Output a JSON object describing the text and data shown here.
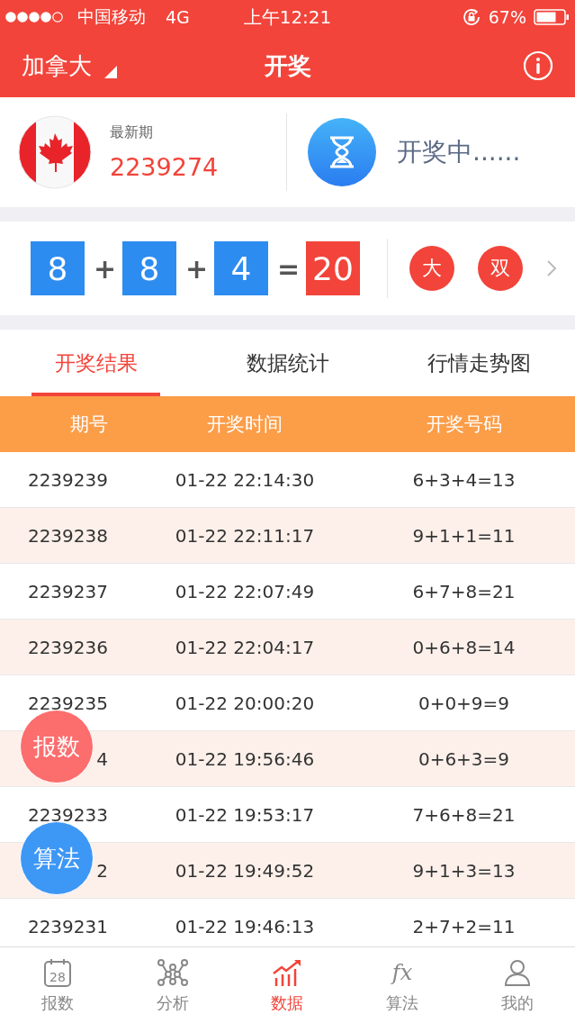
{
  "status_bar": {
    "carrier": "中国移动",
    "network": "4G",
    "time": "上午12:21",
    "battery": "67%"
  },
  "header": {
    "region": "加拿大",
    "title": "开奖"
  },
  "latest": {
    "label": "最新期",
    "issue": "2239274",
    "status": "开奖中......"
  },
  "draw": {
    "numbers": [
      "8",
      "8",
      "4"
    ],
    "plus": "+",
    "equals": "=",
    "sum": "20",
    "tags": [
      "大",
      "双"
    ]
  },
  "tabs": [
    {
      "label": "开奖结果",
      "selected": true
    },
    {
      "label": "数据统计",
      "selected": false
    },
    {
      "label": "行情走势图",
      "selected": false
    }
  ],
  "table": {
    "columns": [
      "期号",
      "开奖时间",
      "开奖号码"
    ],
    "rows": [
      [
        "2239239",
        "01-22 22:14:30",
        "6+3+4=13"
      ],
      [
        "2239238",
        "01-22 22:11:17",
        "9+1+1=11"
      ],
      [
        "2239237",
        "01-22 22:07:49",
        "6+7+8=21"
      ],
      [
        "2239236",
        "01-22 22:04:17",
        "0+6+8=14"
      ],
      [
        "2239235",
        "01-22 20:00:20",
        "0+0+9=9"
      ],
      [
        "4",
        "01-22 19:56:46",
        "0+6+3=9"
      ],
      [
        "2239233",
        "01-22 19:53:17",
        "7+6+8=21"
      ],
      [
        "2",
        "01-22 19:49:52",
        "9+1+3=13"
      ],
      [
        "2239231",
        "01-22 19:46:13",
        "2+7+2=11"
      ]
    ]
  },
  "floating_buttons": [
    {
      "label": "报数",
      "color": "#fc6d6d"
    },
    {
      "label": "算法",
      "color": "#3d97f5"
    }
  ],
  "nav": [
    {
      "label": "报数",
      "kind": "calendar",
      "icon_text": "28",
      "selected": false
    },
    {
      "label": "分析",
      "kind": "network",
      "selected": false
    },
    {
      "label": "数据",
      "kind": "chart",
      "selected": true
    },
    {
      "label": "算法",
      "kind": "formula",
      "icon_text": "fx",
      "selected": false
    },
    {
      "label": "我的",
      "kind": "person",
      "selected": false
    }
  ]
}
